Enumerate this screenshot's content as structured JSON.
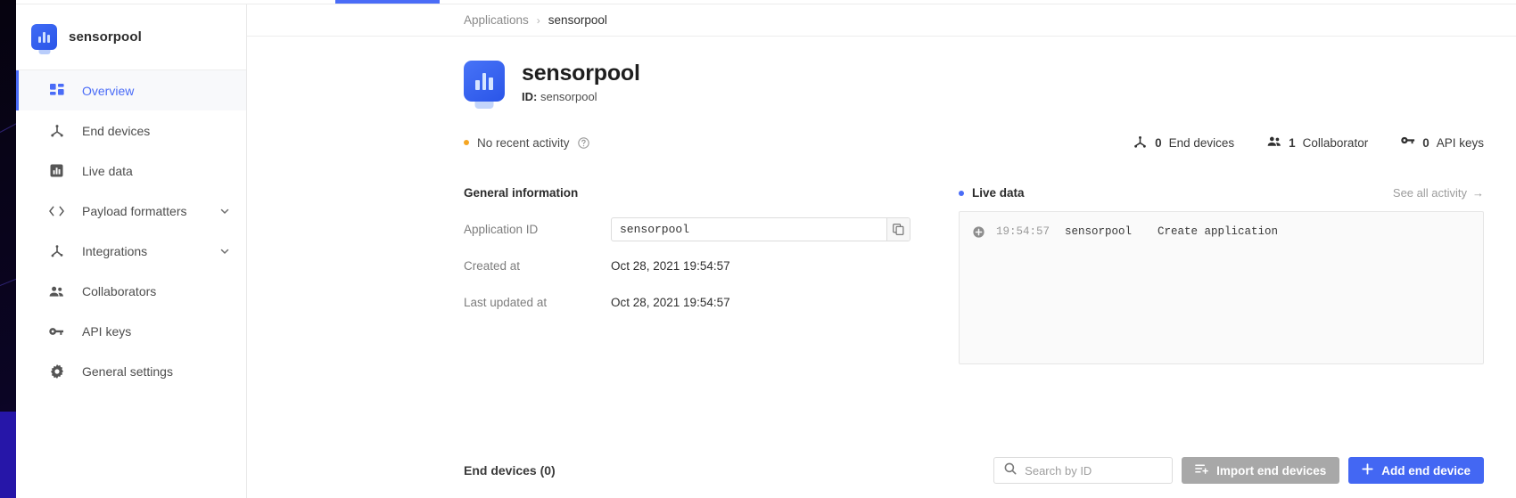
{
  "sidebar": {
    "app_title": "sensorpool",
    "app_icon": "application-tile-icon",
    "items": [
      {
        "label": "Overview",
        "icon": "grid-icon",
        "active": true,
        "chevron": false
      },
      {
        "label": "End devices",
        "icon": "nodes-icon",
        "active": false,
        "chevron": false
      },
      {
        "label": "Live data",
        "icon": "chart-icon",
        "active": false,
        "chevron": false
      },
      {
        "label": "Payload formatters",
        "icon": "code-icon",
        "active": false,
        "chevron": true
      },
      {
        "label": "Integrations",
        "icon": "branch-icon",
        "active": false,
        "chevron": true
      },
      {
        "label": "Collaborators",
        "icon": "people-icon",
        "active": false,
        "chevron": false
      },
      {
        "label": "API keys",
        "icon": "key-icon",
        "active": false,
        "chevron": false
      },
      {
        "label": "General settings",
        "icon": "gear-icon",
        "active": false,
        "chevron": false
      }
    ]
  },
  "breadcrumb": {
    "root": "Applications",
    "separator": "›",
    "current": "sensorpool"
  },
  "hero": {
    "name": "sensorpool",
    "id_label": "ID:",
    "id_value": "sensorpool"
  },
  "status": {
    "activity_text": "No recent activity",
    "activity_dot_color": "#f5a623",
    "help_icon": "help-circle-icon",
    "stats": [
      {
        "count": "0",
        "label": "End devices",
        "icon": "nodes-icon"
      },
      {
        "count": "1",
        "label": "Collaborator",
        "icon": "people-icon"
      },
      {
        "count": "0",
        "label": "API keys",
        "icon": "key-icon"
      }
    ]
  },
  "general_information": {
    "title": "General information",
    "application_id_label": "Application ID",
    "application_id_value": "sensorpool",
    "copy_icon": "copy-icon",
    "created_at_label": "Created at",
    "created_at_value": "Oct 28, 2021 19:54:57",
    "last_updated_label": "Last updated at",
    "last_updated_value": "Oct 28, 2021 19:54:57"
  },
  "live_data": {
    "title": "Live data",
    "dot_color": "#4a6cf7",
    "see_all_label": "See all activity",
    "see_all_arrow": "→",
    "entries": [
      {
        "icon": "plus-circle-icon",
        "time": "19:54:57",
        "entity": "sensorpool",
        "event": "Create application"
      }
    ]
  },
  "bottom": {
    "end_devices_title": "End devices (0)",
    "search_placeholder": "Search by ID",
    "search_value": "",
    "search_icon": "search-icon",
    "import_button": "Import end devices",
    "import_icon": "import-list-icon",
    "add_button": "Add end device",
    "add_icon": "plus-icon"
  },
  "theme": {
    "accent": "#4a6cf7",
    "button_blue": "#4367f3",
    "button_grey": "#a8a8a8",
    "amber": "#f5a623"
  }
}
